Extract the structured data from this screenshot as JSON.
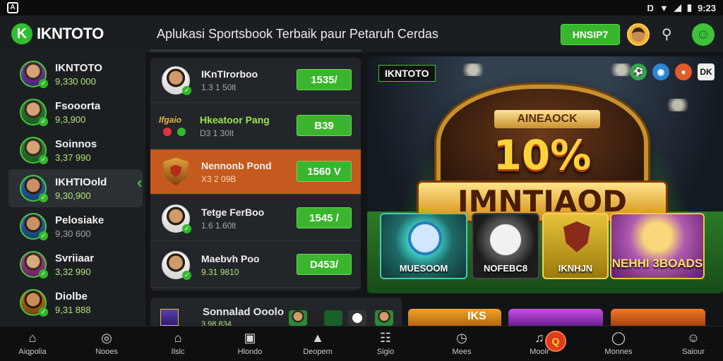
{
  "status": {
    "time": "9:23",
    "icons": [
      "nfc-icon",
      "wifi-icon",
      "signal-icon",
      "battery-icon"
    ]
  },
  "header": {
    "logo_text": "IKNTOTO",
    "tagline": "Aplukasi Sportsbook Terbaik paur Petaruh Cerdas",
    "action_button": "HNSIP7"
  },
  "sidebar": {
    "items": [
      {
        "name": "IKNTOTO",
        "value": "9,330 000"
      },
      {
        "name": "Fsooorta",
        "value": "9,3,900"
      },
      {
        "name": "Soinnos",
        "value": "3,37 990"
      },
      {
        "name": "IKHTIOold",
        "value": "9,30,900"
      },
      {
        "name": "Pelosiake",
        "value": "9,30 600"
      },
      {
        "name": "Svriiaar",
        "value": "3,32 990"
      },
      {
        "name": "Diolbe",
        "value": "9,31 888"
      }
    ]
  },
  "matches": [
    {
      "name": "IKnTIrorboo",
      "sub": "1.3 1 50lt",
      "odds": "1535/"
    },
    {
      "name": "Hkeatoor Pang",
      "sub": "D3 1 30lt",
      "odds": "B39",
      "logo_text": "Ifgaio"
    },
    {
      "name": "Nennonb Pond",
      "sub": "X3 2 09B",
      "odds": "1560 V"
    },
    {
      "name": "Tetge FerBoo",
      "sub": "1.6 1.60lt",
      "odds": "1545 /"
    },
    {
      "name": "Maebvh Poo",
      "sub": "9.31 9810",
      "odds": "D453/"
    }
  ],
  "hero": {
    "badge": "IKNTOTO",
    "ribbon": "AINEAOCK",
    "percent": "10%",
    "word": "IMNTIAOD",
    "corner_icons": [
      "soccer-ball-icon",
      "globe-icon",
      "basketball-icon",
      "dk-icon"
    ],
    "corner_icon_text": "DK",
    "tiles": [
      {
        "label": "MUESOOM"
      },
      {
        "label": "NOFEBC8"
      },
      {
        "label": "IKNHJN"
      },
      {
        "label": "NEHHI 3BOADS"
      }
    ]
  },
  "bottom": {
    "card_name": "Sonnalad Ooolo",
    "card_sub": "3.98.834",
    "card2_text": "IKS"
  },
  "nav": [
    {
      "label": "Aiqpolia",
      "icon": "home-outline-icon"
    },
    {
      "label": "Nooes",
      "icon": "soccer-ball-icon"
    },
    {
      "label": "Ilslc",
      "icon": "home-filled-icon"
    },
    {
      "label": "Hlondo",
      "icon": "document-icon"
    },
    {
      "label": "Deopem",
      "icon": "building-icon"
    },
    {
      "label": "Sigio",
      "icon": "chat-icon"
    },
    {
      "label": "Mees",
      "icon": "clock-icon"
    },
    {
      "label": "Moolr",
      "icon": "music-icon",
      "badge": "Q"
    },
    {
      "label": "Monnes",
      "icon": "shield-icon"
    },
    {
      "label": "Saiour",
      "icon": "user-icon"
    }
  ]
}
